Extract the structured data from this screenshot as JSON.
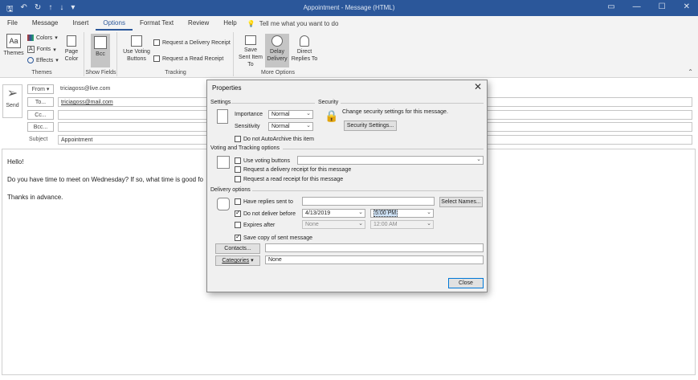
{
  "window": {
    "title": "Appointment - Message (HTML)"
  },
  "menu": {
    "items": [
      "File",
      "Message",
      "Insert",
      "Options",
      "Format Text",
      "Review",
      "Help"
    ],
    "active": "Options",
    "tell_me": "Tell me what you want to do"
  },
  "ribbon": {
    "themes": {
      "themes_label": "Themes",
      "colors_label": "Colors",
      "fonts_label": "Fonts",
      "effects_label": "Effects",
      "page_color_label": "Page Color",
      "group_label": "Themes"
    },
    "show_fields": {
      "bcc_label": "Bcc",
      "group_label": "Show Fields"
    },
    "tracking": {
      "use_voting_label": "Use Voting Buttons",
      "request_delivery_label": "Request a Delivery Receipt",
      "request_read_label": "Request a Read Receipt",
      "group_label": "Tracking"
    },
    "more_options": {
      "save_sent_label": "Save Sent Item To",
      "delay_delivery_label": "Delay Delivery",
      "direct_replies_label": "Direct Replies To",
      "group_label": "More Options"
    }
  },
  "header": {
    "send_label": "Send",
    "from_label": "From",
    "from_value": "triciagoss@live.com",
    "to_label": "To...",
    "to_value": "triciagoss@mail.com",
    "cc_label": "Cc...",
    "bcc_label": "Bcc...",
    "subject_label": "Subject",
    "subject_value": "Appointment"
  },
  "body": {
    "line1": "Hello!",
    "line2": "Do you have time to meet on Wednesday? If so, what time is good fo",
    "line3": "Thanks in advance."
  },
  "dialog": {
    "title": "Properties",
    "settings_label": "Settings",
    "security_label": "Security",
    "importance_label": "Importance",
    "importance_value": "Normal",
    "sensitivity_label": "Sensitivity",
    "sensitivity_value": "Normal",
    "security_text": "Change security settings for this message.",
    "security_button": "Security Settings...",
    "no_autoarchive_label": "Do not AutoArchive this item",
    "voting_section": "Voting and Tracking options",
    "use_voting_label": "Use voting buttons",
    "request_delivery_label": "Request a delivery receipt for this message",
    "request_read_label": "Request a read receipt for this message",
    "delivery_section": "Delivery options",
    "have_replies_label": "Have replies sent to",
    "select_names_button": "Select Names...",
    "do_not_deliver_label": "Do not deliver before",
    "deliver_date": "4/13/2019",
    "deliver_time": "5:00 PM",
    "expires_label": "Expires after",
    "expires_date": "None",
    "expires_time": "12:00 AM",
    "save_copy_label": "Save copy of sent message",
    "contacts_button": "Contacts...",
    "categories_button": "Categories",
    "categories_value": "None",
    "close_button": "Close"
  },
  "colors": {
    "titlebar": "#2b579a",
    "ribbon_bg": "#f3f3f3",
    "dialog_bg": "#f0f0f0",
    "highlight": "#cfe3f7"
  }
}
